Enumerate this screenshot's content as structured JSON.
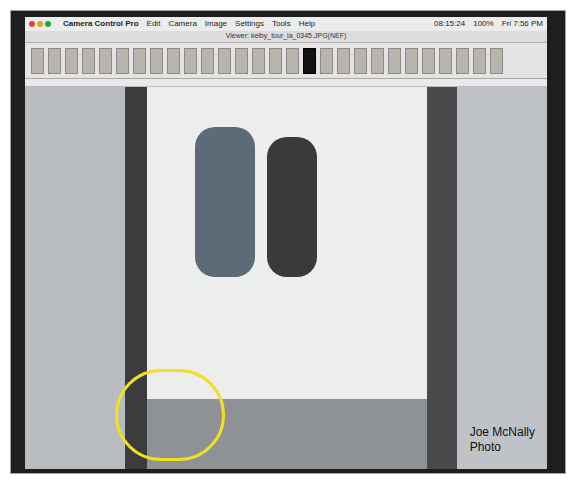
{
  "window": {
    "title": "Viewer: kelby_tour_la_0345.JPG(NEF)"
  },
  "menu": [
    {
      "label": "Camera Control Pro"
    },
    {
      "label": "Edit"
    },
    {
      "label": "Camera"
    },
    {
      "label": "Image"
    },
    {
      "label": "Settings"
    },
    {
      "label": "Tools"
    },
    {
      "label": "Help"
    }
  ],
  "status": {
    "clock": "08:15:24",
    "battery": "100%",
    "datetime": "Fri 7:56 PM"
  },
  "thumbnails": [
    {
      "selected": false
    },
    {
      "selected": false
    },
    {
      "selected": false
    },
    {
      "selected": false
    },
    {
      "selected": false
    },
    {
      "selected": false
    },
    {
      "selected": false
    },
    {
      "selected": false
    },
    {
      "selected": false
    },
    {
      "selected": false
    },
    {
      "selected": false
    },
    {
      "selected": false
    },
    {
      "selected": false
    },
    {
      "selected": false
    },
    {
      "selected": false
    },
    {
      "selected": false
    },
    {
      "selected": true
    },
    {
      "selected": false
    },
    {
      "selected": false
    },
    {
      "selected": false
    },
    {
      "selected": false
    },
    {
      "selected": false
    },
    {
      "selected": false
    },
    {
      "selected": false
    },
    {
      "selected": false
    },
    {
      "selected": false
    },
    {
      "selected": false
    },
    {
      "selected": false
    }
  ],
  "credit": {
    "lines": [
      "Joe McNally",
      "Photo"
    ]
  }
}
